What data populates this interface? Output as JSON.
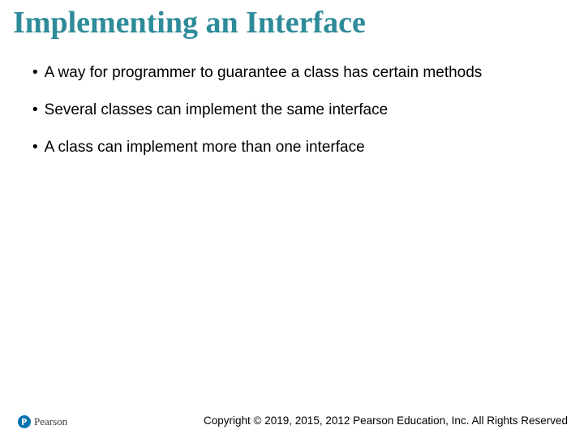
{
  "title": "Implementing an Interface",
  "bullets": [
    "A way for programmer to guarantee a class has certain methods",
    "Several classes can implement the same interface",
    "A class can implement more than one interface"
  ],
  "brand": {
    "name": "Pearson"
  },
  "copyright": "Copyright © 2019, 2015, 2012 Pearson Education, Inc. All Rights Reserved"
}
